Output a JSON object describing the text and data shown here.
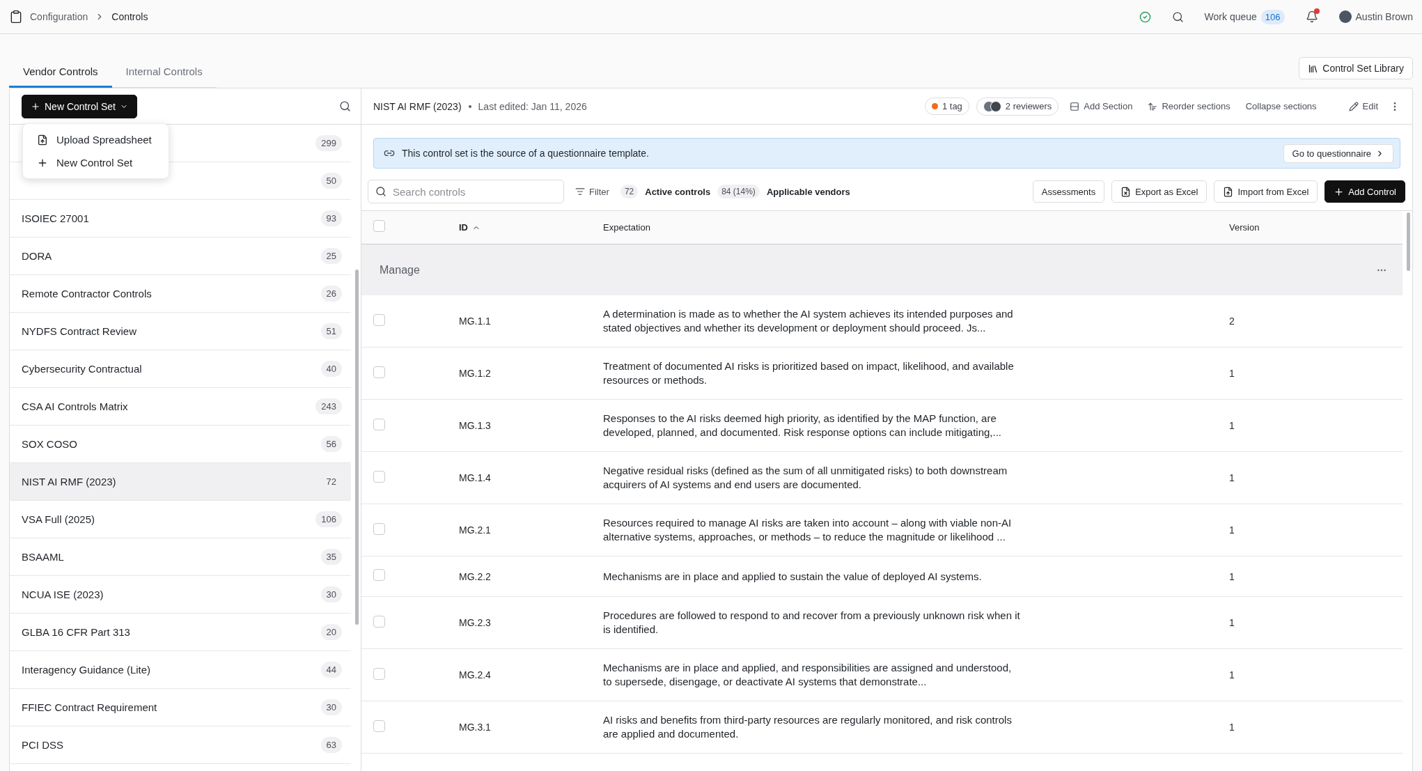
{
  "topbar": {
    "breadcrumbs": [
      "Configuration",
      "Controls"
    ],
    "work_queue": {
      "label": "Work queue",
      "count": "106"
    },
    "notifications_unread": true,
    "user": "Austin Brown"
  },
  "tabs": [
    {
      "label": "Vendor Controls",
      "selected": true
    },
    {
      "label": "Internal Controls",
      "selected": false
    }
  ],
  "library_button": "Control Set Library",
  "sidebar": {
    "new_button": "New Control Set",
    "menu": [
      {
        "label": "Upload Spreadsheet",
        "kind": "upload"
      },
      {
        "label": "New Control Set",
        "kind": "add"
      }
    ],
    "items": [
      {
        "count": "299",
        "selected": false
      },
      {
        "count": "50",
        "selected": false
      },
      {
        "name": "ISOIEC 27001",
        "count": "93",
        "selected": false
      },
      {
        "name": "DORA",
        "count": "25",
        "selected": false
      },
      {
        "name": "Remote Contractor Controls",
        "count": "26",
        "selected": false
      },
      {
        "name": "NYDFS Contract Review",
        "count": "51",
        "selected": false
      },
      {
        "name": "Cybersecurity Contractual",
        "count": "40",
        "selected": false
      },
      {
        "name": "CSA AI Controls Matrix",
        "count": "243",
        "selected": false
      },
      {
        "name": "SOX COSO",
        "count": "56",
        "selected": false
      },
      {
        "name": "NIST AI RMF (2023)",
        "count": "72",
        "selected": true
      },
      {
        "name": "VSA Full (2025)",
        "count": "106",
        "selected": false
      },
      {
        "name": "BSAAML",
        "count": "35",
        "selected": false
      },
      {
        "name": "NCUA ISE (2023)",
        "count": "30",
        "selected": false
      },
      {
        "name": "GLBA 16 CFR Part 313",
        "count": "20",
        "selected": false
      },
      {
        "name": "Interagency Guidance (Lite)",
        "count": "44",
        "selected": false
      },
      {
        "name": "FFIEC Contract Requirement",
        "count": "30",
        "selected": false
      },
      {
        "name": "PCI DSS",
        "count": "63",
        "selected": false
      }
    ]
  },
  "detail": {
    "title": "NIST AI RMF (2023)",
    "last_edited": "Last edited: Jan 11, 2026",
    "tag": "1 tag",
    "reviewers": "2 reviewers",
    "actions": [
      {
        "label": "Add Section",
        "kind": "section"
      },
      {
        "label": "Reorder sections",
        "kind": "reorder"
      },
      {
        "label": "Collapse sections",
        "kind": "plain"
      },
      {
        "label": "Edit",
        "kind": "edit"
      }
    ],
    "banner": {
      "text": "This control set is the source of a questionnaire template.",
      "button": "Go to questionnaire"
    },
    "search": {
      "placeholder": "Search controls"
    },
    "filter": "Filter",
    "stats": [
      {
        "count": "72",
        "label": "Active controls"
      },
      {
        "count": "84 (14%)",
        "label": "Applicable vendors"
      }
    ],
    "buttons": [
      {
        "label": "Assessments",
        "kind": "plain"
      },
      {
        "label": "Export as Excel",
        "kind": "export"
      },
      {
        "label": "Import from Excel",
        "kind": "import"
      },
      {
        "label": "Add Control",
        "kind": "primary"
      }
    ]
  },
  "table": {
    "header_checked": false,
    "columns": [
      {
        "label": "ID",
        "sort_ascending": true
      },
      {
        "label": "Expectation"
      },
      {
        "label": "Version"
      }
    ],
    "group": "Manage",
    "rows": [
      {
        "id": "MG.1.1",
        "expectation": "A determination is made as to whether the AI system achieves its intended purposes and stated objectives and whether its development or deployment should proceed. Js...",
        "version": "2",
        "checked": false
      },
      {
        "id": "MG.1.2",
        "expectation": "Treatment of documented AI risks is prioritized based on impact, likelihood, and available resources or methods.",
        "version": "1",
        "checked": false
      },
      {
        "id": "MG.1.3",
        "expectation": "Responses to the AI risks deemed high priority, as identified by the MAP function, are developed, planned, and documented. Risk response options can include mitigating,...",
        "version": "1",
        "checked": false
      },
      {
        "id": "MG.1.4",
        "expectation": "Negative residual risks (defined as the sum of all unmitigated risks) to both downstream acquirers of AI systems and end users are documented.",
        "version": "1",
        "checked": false
      },
      {
        "id": "MG.2.1",
        "expectation": "Resources required to manage AI risks are taken into account – along with viable non-AI alternative systems, approaches, or methods – to reduce the magnitude or likelihood ...",
        "version": "1",
        "checked": false
      },
      {
        "id": "MG.2.2",
        "expectation": "Mechanisms are in place and applied to sustain the value of deployed AI systems.",
        "version": "1",
        "checked": false
      },
      {
        "id": "MG.2.3",
        "expectation": "Procedures are followed to respond to and recover from a previously unknown risk when it is identified.",
        "version": "1",
        "checked": false
      },
      {
        "id": "MG.2.4",
        "expectation": "Mechanisms are in place and applied, and responsibilities are assigned and understood, to supersede, disengage, or deactivate AI systems that demonstrate...",
        "version": "1",
        "checked": false
      },
      {
        "id": "MG.3.1",
        "expectation": "AI risks and benefits from third-party resources are regularly monitored, and risk controls are applied and documented.",
        "version": "1",
        "checked": false
      }
    ]
  }
}
